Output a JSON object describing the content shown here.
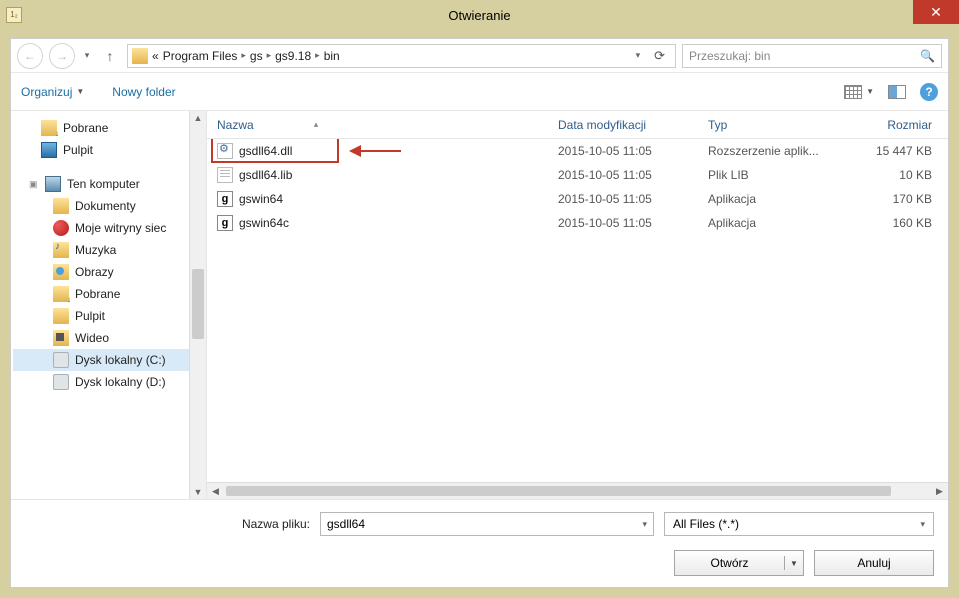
{
  "titlebar": {
    "title": "Otwieranie"
  },
  "address": {
    "prefix": "«",
    "crumbs": [
      "Program Files",
      "gs",
      "gs9.18",
      "bin"
    ]
  },
  "search": {
    "placeholder": "Przeszukaj: bin"
  },
  "toolbar": {
    "organize": "Organizuj",
    "new_folder": "Nowy folder"
  },
  "sidebar": {
    "quick": [
      {
        "label": "Pobrane",
        "icon": "download"
      },
      {
        "label": "Pulpit",
        "icon": "desktop"
      }
    ],
    "group_computer": "Ten komputer",
    "computer": [
      {
        "label": "Dokumenty",
        "icon": "folder"
      },
      {
        "label": "Moje witryny siec",
        "icon": "globe"
      },
      {
        "label": "Muzyka",
        "icon": "music"
      },
      {
        "label": "Obrazy",
        "icon": "images"
      },
      {
        "label": "Pobrane",
        "icon": "download"
      },
      {
        "label": "Pulpit",
        "icon": "folder"
      },
      {
        "label": "Wideo",
        "icon": "video"
      },
      {
        "label": "Dysk lokalny (C:)",
        "icon": "drive",
        "selected": true
      },
      {
        "label": "Dysk lokalny (D:)",
        "icon": "drive"
      }
    ]
  },
  "columns": {
    "name": "Nazwa",
    "date": "Data modyfikacji",
    "type": "Typ",
    "size": "Rozmiar"
  },
  "files": [
    {
      "name": "gsdll64.dll",
      "date": "2015-10-05 11:05",
      "type": "Rozszerzenie aplik...",
      "size": "15 447 KB",
      "icon": "gear",
      "annotated": true
    },
    {
      "name": "gsdll64.lib",
      "date": "2015-10-05 11:05",
      "type": "Plik LIB",
      "size": "10 KB",
      "icon": "sheet"
    },
    {
      "name": "gswin64",
      "date": "2015-10-05 11:05",
      "type": "Aplikacja",
      "size": "170 KB",
      "icon": "app"
    },
    {
      "name": "gswin64c",
      "date": "2015-10-05 11:05",
      "type": "Aplikacja",
      "size": "160 KB",
      "icon": "app"
    }
  ],
  "bottom": {
    "filename_label": "Nazwa pliku:",
    "filename_value": "gsdll64",
    "filter": "All Files (*.*)",
    "open": "Otwórz",
    "cancel": "Anuluj"
  },
  "app_icon_text": "1₂"
}
